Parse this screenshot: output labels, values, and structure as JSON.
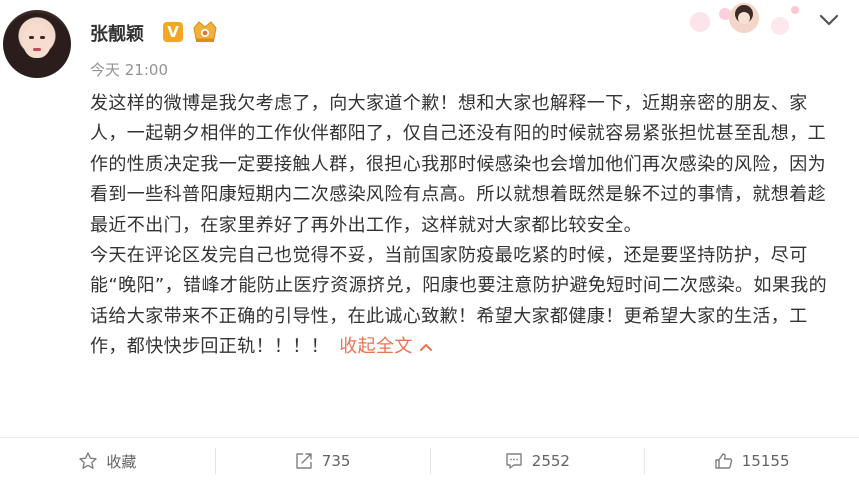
{
  "post": {
    "author": "张靓颖",
    "verified_badge": "V",
    "time": "今天 21:00",
    "paragraphs": [
      "发这样的微博是我欠考虑了，向大家道个歉！想和大家也解释一下，近期亲密的朋友、家人，一起朝夕相伴的工作伙伴都阳了，仅自己还没有阳的时候就容易紧张担忧甚至乱想，工作的性质决定我一定要接触人群，很担心我那时候感染也会增加他们再次感染的风险，因为看到一些科普阳康短期内二次感染风险有点高。所以就想着既然是躲不过的事情，就想着趁最近不出门，在家里养好了再外出工作，这样就对大家都比较安全。",
      "今天在评论区发完自己也觉得不妥，当前国家防疫最吃紧的时候，还是要坚持防护，尽可能“晚阳”，错峰才能防止医疗资源挤兑，阳康也要注意防护避免短时间二次感染。如果我的话给大家带来不正确的引导性，在此诚心致歉！希望大家都健康！更希望大家的生活，工作，都快快步回正轨！！！！"
    ],
    "collapse_label": "收起全文"
  },
  "actions": {
    "favorite": "收藏",
    "repost": "735",
    "comment": "2552",
    "like": "15155"
  },
  "icons": {
    "favorite": "star-icon",
    "repost": "share-icon",
    "comment": "comment-icon",
    "like": "thumbs-up-icon",
    "menu": "chevron-down-icon",
    "level": "crown-badge-icon"
  },
  "colors": {
    "accent": "#eb7350",
    "badge": "#f5a623",
    "muted": "#939393"
  }
}
